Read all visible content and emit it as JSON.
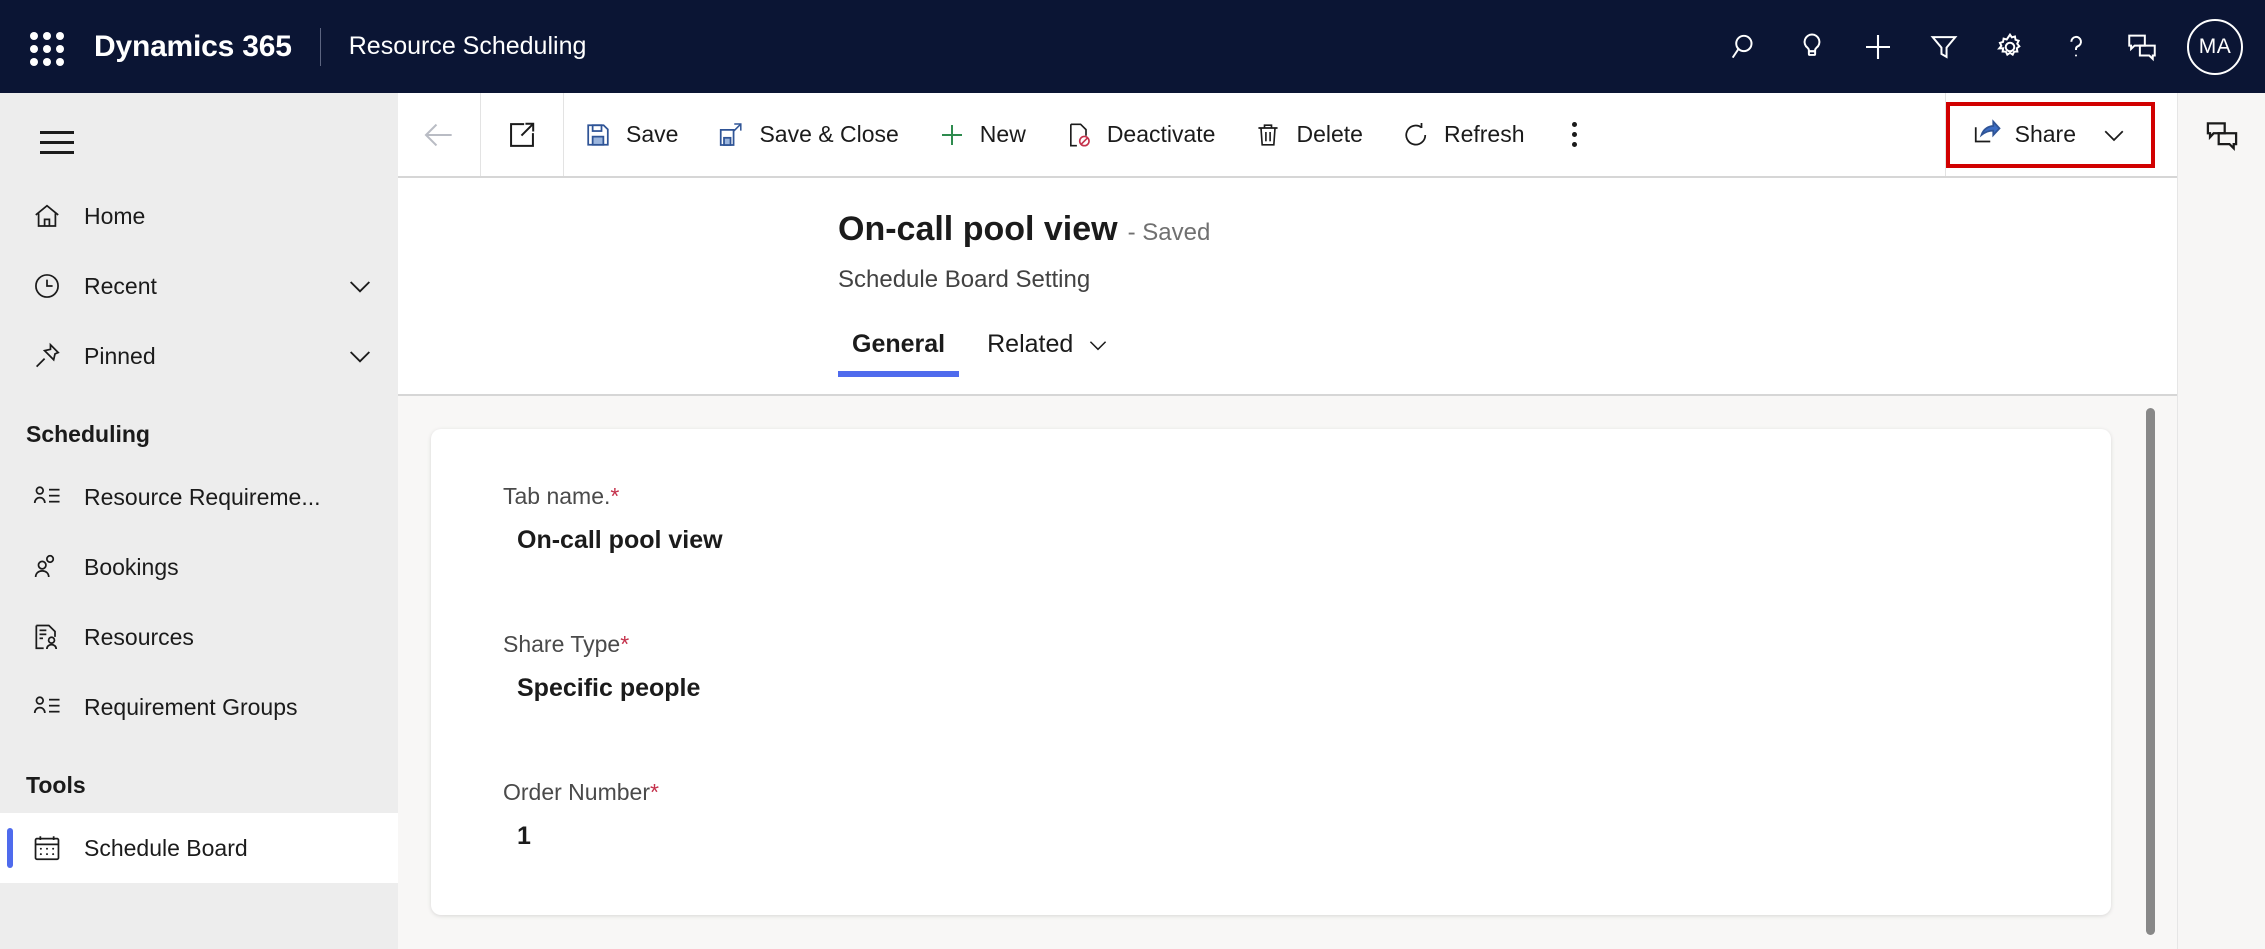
{
  "topbar": {
    "waffle_icon": "app-launcher-icon",
    "brand": "Dynamics 365",
    "app_name": "Resource Scheduling",
    "bg_color": "#0b1534",
    "icons": [
      {
        "name": "search-icon",
        "label": "Search"
      },
      {
        "name": "lightbulb-icon",
        "label": "Insights"
      },
      {
        "name": "plus-icon",
        "label": "Quick create"
      },
      {
        "name": "filter-icon",
        "label": "Filter"
      },
      {
        "name": "gear-icon",
        "label": "Settings"
      },
      {
        "name": "question-icon",
        "label": "Help"
      },
      {
        "name": "feedback-icon",
        "label": "Feedback"
      }
    ],
    "avatar": "MA"
  },
  "sidebar": {
    "hamburger_icon": "hamburger-icon",
    "bg_color": "#ededed",
    "items": [
      {
        "label": "Home",
        "icon": "home-icon",
        "chevron": false,
        "selected": false
      },
      {
        "label": "Recent",
        "icon": "clock-icon",
        "chevron": true,
        "selected": false
      },
      {
        "label": "Pinned",
        "icon": "pin-icon",
        "chevron": true,
        "selected": false
      }
    ],
    "groups": [
      {
        "title": "Scheduling",
        "items": [
          {
            "label": "Resource Requireme...",
            "icon": "person-list-icon",
            "selected": false
          },
          {
            "label": "Bookings",
            "icon": "people-icon",
            "selected": false
          },
          {
            "label": "Resources",
            "icon": "document-person-icon",
            "selected": false
          },
          {
            "label": "Requirement Groups",
            "icon": "person-list-icon",
            "selected": false
          }
        ]
      },
      {
        "title": "Tools",
        "items": [
          {
            "label": "Schedule Board",
            "icon": "calendar-icon",
            "selected": true
          }
        ]
      }
    ],
    "selected_accent": "#4f6bed"
  },
  "commandbar": {
    "back_icon": "back-arrow-icon",
    "popout_icon": "pop-out-icon",
    "buttons": [
      {
        "label": "Save",
        "icon": "save-icon"
      },
      {
        "label": "Save & Close",
        "icon": "save-close-icon"
      },
      {
        "label": "New",
        "icon": "plus-icon"
      },
      {
        "label": "Deactivate",
        "icon": "deactivate-icon"
      },
      {
        "label": "Delete",
        "icon": "trash-icon"
      },
      {
        "label": "Refresh",
        "icon": "refresh-icon"
      }
    ],
    "overflow_icon": "more-options-icon",
    "share": {
      "label": "Share",
      "icon": "share-icon",
      "chevron_icon": "chevron-down-icon",
      "highlight_color": "#d10000"
    }
  },
  "rightrail": {
    "icon": "chat-assistant-icon"
  },
  "form": {
    "record_name": "On-call pool view",
    "record_state": "- Saved",
    "entity_name": "Schedule Board Setting",
    "tabs": [
      {
        "label": "General",
        "active": true,
        "chevron": false
      },
      {
        "label": "Related",
        "active": false,
        "chevron": true
      }
    ],
    "tab_accent": "#4f6bed",
    "fields": [
      {
        "label": "Tab name.",
        "required": true,
        "value": "On-call pool view"
      },
      {
        "label": "Share Type",
        "required": true,
        "value": "Specific people"
      },
      {
        "label": "Order Number",
        "required": true,
        "value": "1"
      }
    ],
    "scrollbar": "vertical-scrollbar"
  }
}
